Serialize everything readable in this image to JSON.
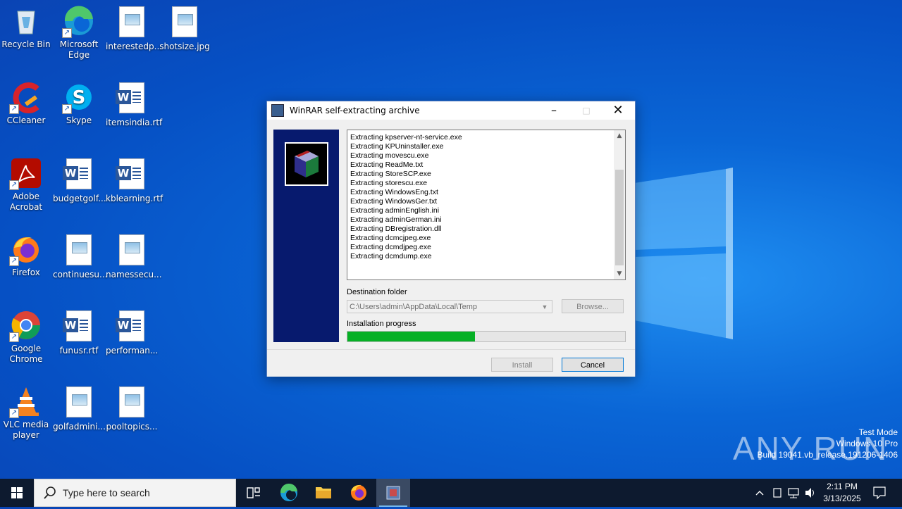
{
  "desktop": {
    "icons": [
      {
        "label": "Recycle Bin",
        "icon": "recycle-bin-icon"
      },
      {
        "label": "Microsoft Edge",
        "icon": "edge-icon"
      },
      {
        "label": "interestedp...",
        "icon": "image-file-icon"
      },
      {
        "label": "shotsize.jpg",
        "icon": "image-file-icon"
      },
      {
        "label": "CCleaner",
        "icon": "ccleaner-icon"
      },
      {
        "label": "Skype",
        "icon": "skype-icon"
      },
      {
        "label": "itemsindia.rtf",
        "icon": "word-file-icon"
      },
      {
        "label": "Adobe Acrobat",
        "icon": "acrobat-icon"
      },
      {
        "label": "budgetgolf...",
        "icon": "word-file-icon"
      },
      {
        "label": "kblearning.rtf",
        "icon": "word-file-icon"
      },
      {
        "label": "Firefox",
        "icon": "firefox-icon"
      },
      {
        "label": "continuesu...",
        "icon": "image-file-icon"
      },
      {
        "label": "namessecu...",
        "icon": "image-file-icon"
      },
      {
        "label": "Google Chrome",
        "icon": "chrome-icon"
      },
      {
        "label": "funusr.rtf",
        "icon": "word-file-icon"
      },
      {
        "label": "performan...",
        "icon": "word-file-icon"
      },
      {
        "label": "VLC media player",
        "icon": "vlc-icon"
      },
      {
        "label": "golfadmini...",
        "icon": "image-file-icon"
      },
      {
        "label": "pooltopics...",
        "icon": "image-file-icon"
      }
    ]
  },
  "dialog": {
    "title": "WinRAR self-extracting archive",
    "log_lines": [
      "Extracting kpserver-nt-service.exe",
      "Extracting KPUninstaller.exe",
      "Extracting movescu.exe",
      "Extracting ReadMe.txt",
      "Extracting StoreSCP.exe",
      "Extracting storescu.exe",
      "Extracting WindowsEng.txt",
      "Extracting WindowsGer.txt",
      "Extracting adminEnglish.ini",
      "Extracting adminGerman.ini",
      "Extracting DBregistration.dll",
      "Extracting dcmcjpeg.exe",
      "Extracting dcmdjpeg.exe",
      "Extracting dcmdump.exe"
    ],
    "destination_label": "Destination folder",
    "destination_value": "C:\\Users\\admin\\AppData\\Local\\Temp",
    "browse_label": "Browse...",
    "progress_label": "Installation progress",
    "progress_fraction": 0.46,
    "install_label": "Install",
    "cancel_label": "Cancel"
  },
  "watermark": {
    "brand": "ANY RUN",
    "line1": "Test Mode",
    "line2": "Windows 10 Pro",
    "line3": "Build 19041.vb_release.191206-1406"
  },
  "taskbar": {
    "search_placeholder": "Type here to search",
    "time": "2:11 PM",
    "date": "3/13/2025"
  },
  "colors": {
    "desktop_blue": "#0a66d6",
    "taskbar": "#0d1a2f",
    "progress_green": "#06b025",
    "banner_navy": "#071a6e"
  }
}
